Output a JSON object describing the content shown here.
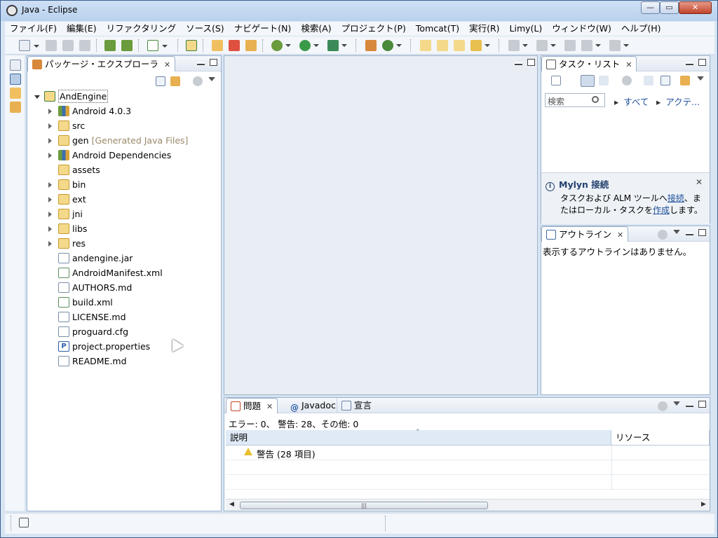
{
  "window": {
    "title": "Java - Eclipse"
  },
  "menu": [
    "ファイル(F)",
    "編集(E)",
    "リファクタリング",
    "ソース(S)",
    "ナビゲート(N)",
    "検索(A)",
    "プロジェクト(P)",
    "Tomcat(T)",
    "実行(R)",
    "Limy(L)",
    "ウィンドウ(W)",
    "ヘルプ(H)"
  ],
  "toolbar_icons": [
    "new-icon",
    "save-icon",
    "save-all-icon",
    "print-icon",
    "import-icon",
    "export-icon",
    "validate-icon",
    "new-android-icon",
    "tomcat-start-icon",
    "tomcat-stop-icon",
    "tomcat-restart-icon",
    "debug-icon",
    "run-icon",
    "external-tools-icon",
    "new-java-project-icon",
    "refresh-icon",
    "open-type-icon",
    "open-folder-icon",
    "open-file-icon",
    "pin-icon",
    "next-annotation-icon",
    "prev-annotation-icon",
    "last-edit-icon",
    "back-icon",
    "forward-icon"
  ],
  "colors": {
    "accent": "#1f4f9a",
    "frame": "#d7e4f2",
    "panel_border": "#9eb3cc",
    "folder": "#f5d98a",
    "decoration": "#9a8a6a"
  },
  "package_explorer": {
    "tab_label": "パッケージ・エクスプローラ",
    "tree": [
      {
        "label": "AndEngine",
        "icon": "project-icon",
        "level": 0,
        "expanded": true
      },
      {
        "label": "Android 4.0.3",
        "icon": "library-icon",
        "level": 1,
        "expanded": false
      },
      {
        "label": "src",
        "icon": "source-folder-icon",
        "level": 1,
        "expanded": false
      },
      {
        "label": "gen",
        "decoration": "[Generated Java Files]",
        "icon": "source-folder-icon",
        "level": 1,
        "expanded": false
      },
      {
        "label": "Android Dependencies",
        "icon": "library-icon",
        "level": 1,
        "expanded": false
      },
      {
        "label": "assets",
        "icon": "folder-icon",
        "level": 1,
        "leaf": true
      },
      {
        "label": "bin",
        "icon": "folder-icon",
        "level": 1,
        "expanded": false
      },
      {
        "label": "ext",
        "icon": "folder-icon",
        "level": 1,
        "expanded": false
      },
      {
        "label": "jni",
        "icon": "folder-icon",
        "level": 1,
        "expanded": false
      },
      {
        "label": "libs",
        "icon": "folder-icon",
        "level": 1,
        "expanded": false
      },
      {
        "label": "res",
        "icon": "folder-icon",
        "level": 1,
        "expanded": false
      },
      {
        "label": "andengine.jar",
        "icon": "jar-icon",
        "level": 1,
        "leaf": true
      },
      {
        "label": "AndroidManifest.xml",
        "icon": "xml-file-icon",
        "level": 1,
        "leaf": true
      },
      {
        "label": "AUTHORS.md",
        "icon": "text-file-icon",
        "level": 1,
        "leaf": true
      },
      {
        "label": "build.xml",
        "icon": "xml-file-icon",
        "level": 1,
        "leaf": true
      },
      {
        "label": "LICENSE.md",
        "icon": "text-file-icon",
        "level": 1,
        "leaf": true
      },
      {
        "label": "proguard.cfg",
        "icon": "text-file-icon",
        "level": 1,
        "leaf": true
      },
      {
        "label": "project.properties",
        "icon": "properties-file-icon",
        "level": 1,
        "leaf": true
      },
      {
        "label": "README.md",
        "icon": "text-file-icon",
        "level": 1,
        "leaf": true
      }
    ]
  },
  "task_list": {
    "tab_label": "タスク・リスト",
    "filter_placeholder": "検索",
    "link_all": "すべて",
    "link_active": "アクテ...",
    "mylyn": {
      "title": "Mylyn 接続",
      "text_before": "タスクおよび ALM ツールへ",
      "link_connect": "接続",
      "text_middle": "、またはローカル・タスクを",
      "link_create": "作成",
      "text_after": "します。"
    }
  },
  "outline": {
    "tab_label": "アウトライン",
    "message": "表示するアウトラインはありません。"
  },
  "problems": {
    "tabs": [
      "問題",
      "Javadoc",
      "宣言"
    ],
    "summary": "エラー: 0、 警告: 28、その他: 0",
    "columns": [
      "説明",
      "リソース"
    ],
    "rows": [
      {
        "description": "警告 (28 項目)",
        "resource": ""
      }
    ]
  }
}
